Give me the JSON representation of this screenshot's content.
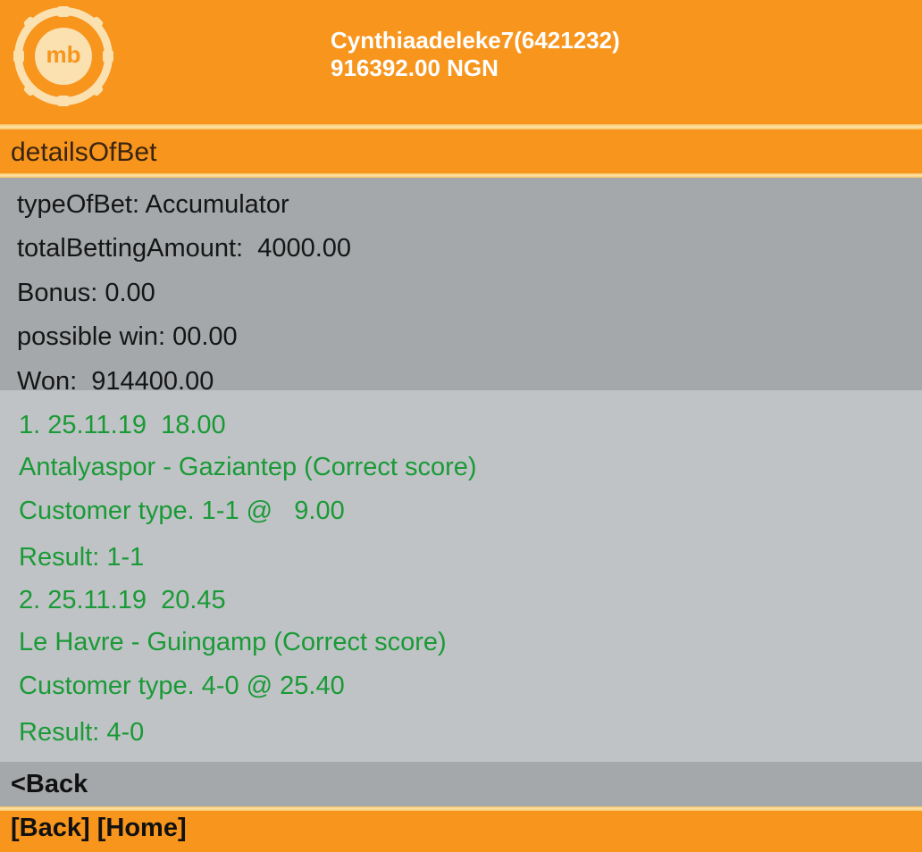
{
  "header": {
    "logo_text": "mb",
    "username": "Cynthiaadeleke7(6421232)",
    "balance": "916392.00 NGN"
  },
  "section": {
    "title": "detailsOfBet"
  },
  "summary": {
    "type_of_bet": "typeOfBet: Accumulator",
    "total_betting_amount": "totalBettingAmount:  4000.00",
    "bonus": "Bonus: 0.00",
    "possible_win": "possible win: 00.00",
    "won": "Won:  914400.00"
  },
  "selections": [
    {
      "header": "1. 25.11.19  18.00",
      "match": "Antalyaspor - Gaziantep (Correct score)",
      "pick": "Customer type. 1-1 @   9.00",
      "result": "Result: 1-1"
    },
    {
      "header": "2. 25.11.19  20.45",
      "match": "Le Havre - Guingamp (Correct score)",
      "pick": "Customer type. 4-0 @ 25.40",
      "result": "Result: 4-0"
    }
  ],
  "navigation": {
    "back_link": "<Back",
    "footer_back": "[Back]",
    "footer_home": "[Home]"
  },
  "colors": {
    "brand_orange": "#f7951d",
    "selection_text": "#1a9a36",
    "summary_bg": "#a4a8aa",
    "content_bg": "#bfc3c6"
  },
  "icons": {
    "logo": "poker-chip-logo-icon"
  }
}
